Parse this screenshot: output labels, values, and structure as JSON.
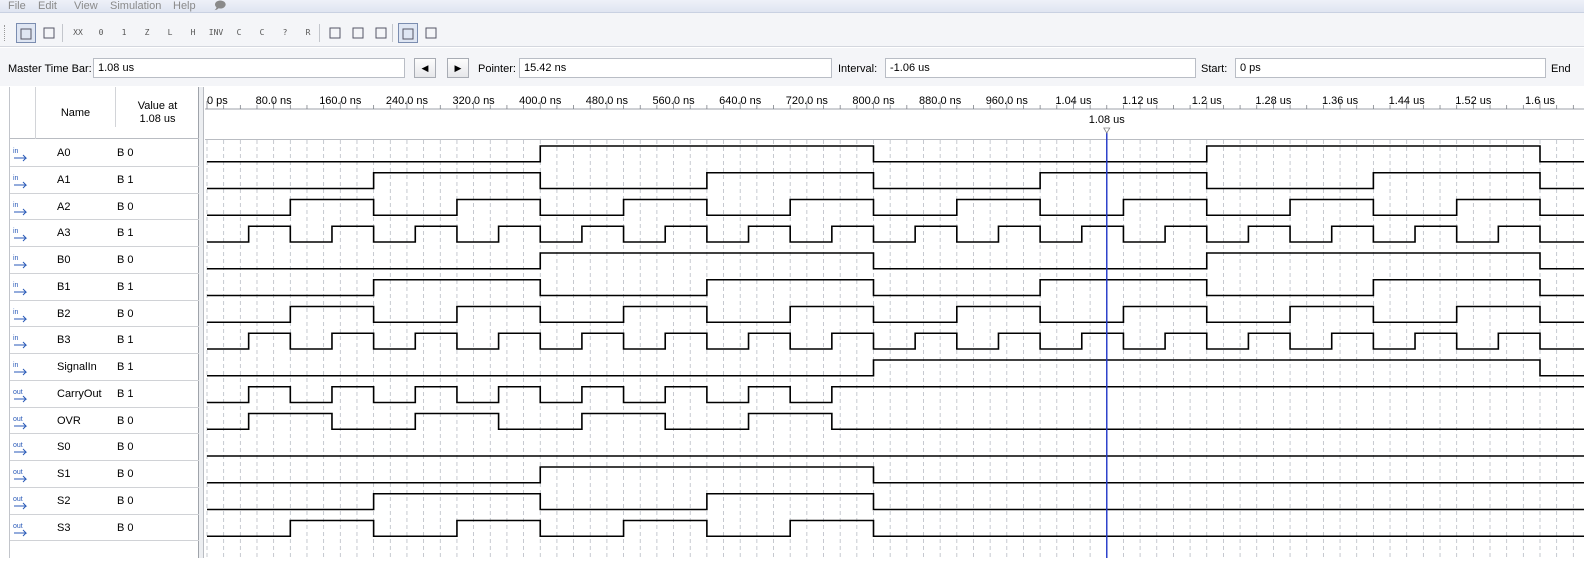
{
  "menu": [
    "File",
    "Edit",
    "View",
    "Simulation",
    "Help"
  ],
  "toolbar": {
    "buttons": [
      {
        "icon": "selection-tool-icon",
        "label": "",
        "active": true
      },
      {
        "icon": "zoom-tool-icon",
        "label": "",
        "active": false
      },
      {
        "icon": "forcing-unknown-icon",
        "label": "XX",
        "active": false
      },
      {
        "icon": "forcing-low-icon",
        "label": "0",
        "active": false
      },
      {
        "icon": "forcing-high-icon",
        "label": "1",
        "active": false
      },
      {
        "icon": "high-impedance-icon",
        "label": "Z",
        "active": false
      },
      {
        "icon": "weak-low-icon",
        "label": "L",
        "active": false
      },
      {
        "icon": "weak-high-icon",
        "label": "H",
        "active": false
      },
      {
        "icon": "invert-icon",
        "label": "INV",
        "active": false
      },
      {
        "icon": "count-value-icon",
        "label": "C",
        "active": false
      },
      {
        "icon": "clock-icon",
        "label": "C",
        "active": false
      },
      {
        "icon": "random-value-icon",
        "label": "?",
        "active": false
      },
      {
        "icon": "arbitrary-value-icon",
        "label": "R",
        "active": false
      },
      {
        "icon": "snap-to-transition-icon",
        "label": "",
        "active": false
      },
      {
        "icon": "insert-node-icon",
        "label": "",
        "active": false
      },
      {
        "icon": "find-icon",
        "label": "",
        "active": false
      },
      {
        "icon": "grid-icon",
        "label": "",
        "active": true
      },
      {
        "icon": "node-finder-icon",
        "label": "",
        "active": false
      }
    ]
  },
  "timebar": {
    "master_label": "Master Time Bar:",
    "master_value": "1.08 us",
    "pointer_label": "Pointer:",
    "pointer_value": "15.42 ns",
    "interval_label": "Interval:",
    "interval_value": "-1.06 us",
    "start_label": "Start:",
    "start_value": "0 ps",
    "end_label": "End"
  },
  "headers": {
    "name": "Name",
    "value_line1": "Value at",
    "value_line2": "1.08 us"
  },
  "ruler": {
    "ticks": [
      "0 ps",
      "80.0 ns",
      "160.0 ns",
      "240.0 ns",
      "320.0 ns",
      "400.0 ns",
      "480.0 ns",
      "560.0 ns",
      "640.0 ns",
      "720.0 ns",
      "800.0 ns",
      "880.0 ns",
      "960.0 ns",
      "1.04 us",
      "1.12 us",
      "1.2 us",
      "1.28 us",
      "1.36 us",
      "1.44 us",
      "1.52 us",
      "1.6 us"
    ],
    "ticks_ns": [
      0,
      80,
      160,
      240,
      320,
      400,
      480,
      560,
      640,
      720,
      800,
      880,
      960,
      1040,
      1120,
      1200,
      1280,
      1360,
      1440,
      1520,
      1600
    ],
    "cursor_label": "1.08 us",
    "cursor_ns": 1080,
    "view_end_ns": 1650
  },
  "signals": [
    {
      "dir": "in",
      "name": "A0",
      "value": "B 0",
      "transitions": [
        400,
        800,
        1200,
        1600
      ]
    },
    {
      "dir": "in",
      "name": "A1",
      "value": "B 1",
      "transitions": [
        200,
        400,
        600,
        800,
        1000,
        1200,
        1400,
        1600
      ]
    },
    {
      "dir": "in",
      "name": "A2",
      "value": "B 0",
      "transitions": [
        100,
        200,
        300,
        400,
        500,
        600,
        700,
        800,
        900,
        1000,
        1100,
        1200,
        1300,
        1400,
        1500,
        1600
      ]
    },
    {
      "dir": "in",
      "name": "A3",
      "value": "B 1",
      "transitions": [
        50,
        100,
        150,
        200,
        250,
        300,
        350,
        400,
        450,
        500,
        550,
        600,
        650,
        700,
        750,
        800,
        850,
        900,
        950,
        1000,
        1050,
        1100,
        1150,
        1200,
        1250,
        1300,
        1350,
        1400,
        1450,
        1500,
        1550,
        1600
      ]
    },
    {
      "dir": "in",
      "name": "B0",
      "value": "B 0",
      "transitions": [
        400,
        800,
        1200,
        1600
      ]
    },
    {
      "dir": "in",
      "name": "B1",
      "value": "B 1",
      "transitions": [
        200,
        400,
        600,
        800,
        1000,
        1200,
        1400,
        1600
      ]
    },
    {
      "dir": "in",
      "name": "B2",
      "value": "B 0",
      "transitions": [
        100,
        200,
        300,
        400,
        500,
        600,
        700,
        800,
        900,
        1000,
        1100,
        1200,
        1300,
        1400,
        1500,
        1600
      ]
    },
    {
      "dir": "in",
      "name": "B3",
      "value": "B 1",
      "transitions": [
        50,
        100,
        150,
        200,
        250,
        300,
        350,
        400,
        450,
        500,
        550,
        600,
        650,
        700,
        750,
        800,
        850,
        900,
        950,
        1000,
        1050,
        1100,
        1150,
        1200,
        1250,
        1300,
        1350,
        1400,
        1450,
        1500,
        1550,
        1600
      ]
    },
    {
      "dir": "in",
      "name": "SignalIn",
      "value": "B 1",
      "transitions": [
        800,
        1600
      ]
    },
    {
      "dir": "out",
      "name": "CarryOut",
      "value": "B 1",
      "transitions": [
        50,
        100,
        150,
        200,
        250,
        300,
        350,
        400,
        450,
        500,
        550,
        600,
        650,
        700,
        750
      ]
    },
    {
      "dir": "out",
      "name": "OVR",
      "value": "B 0",
      "transitions": [
        50,
        150,
        250,
        350,
        450,
        550,
        650,
        750
      ]
    },
    {
      "dir": "out",
      "name": "S0",
      "value": "B 0",
      "transitions": []
    },
    {
      "dir": "out",
      "name": "S1",
      "value": "B 0",
      "transitions": [
        400,
        800
      ]
    },
    {
      "dir": "out",
      "name": "S2",
      "value": "B 0",
      "transitions": [
        200,
        400,
        600,
        800
      ]
    },
    {
      "dir": "out",
      "name": "S3",
      "value": "B 0",
      "transitions": [
        100,
        200,
        300,
        400,
        500,
        600,
        700,
        800
      ]
    }
  ],
  "colors": {
    "cursor": "#1f35c8",
    "grid": "#b8bcc4",
    "wave": "#000000",
    "in_icon": "#2a5ab8",
    "out_icon": "#2a5ab8"
  }
}
